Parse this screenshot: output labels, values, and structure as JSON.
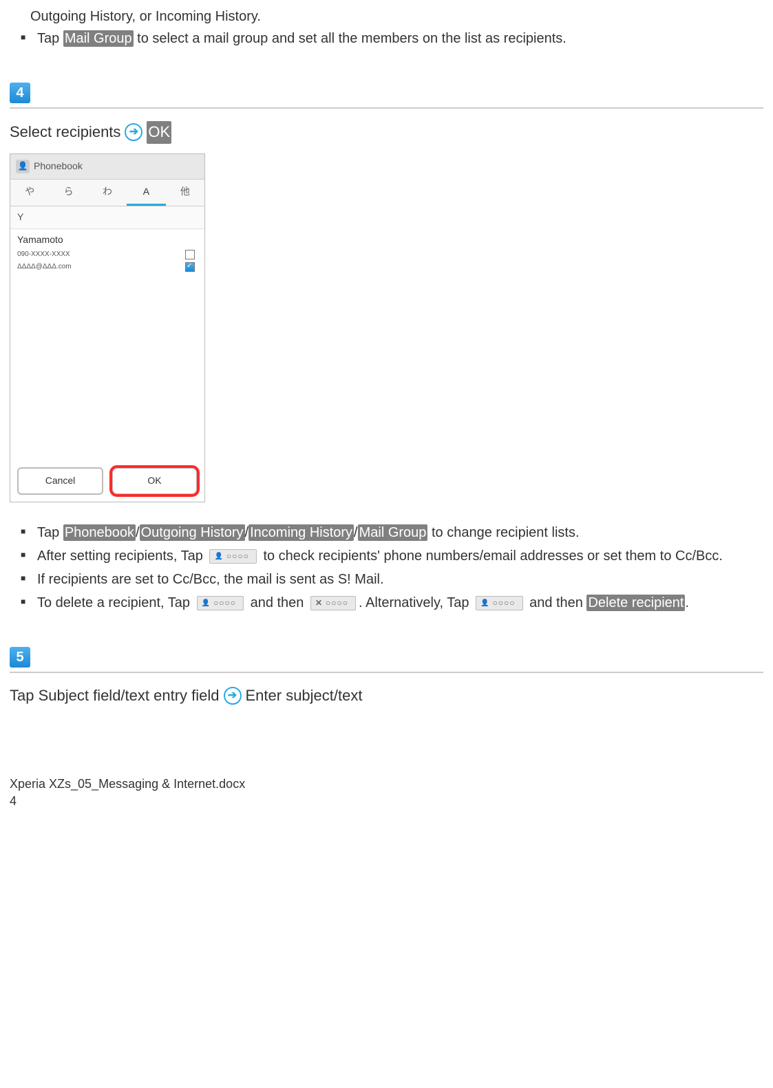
{
  "intro_fragment": "Outgoing History, or Incoming History.",
  "top_bullets": {
    "b1_pre": "Tap ",
    "b1_pill": "Mail Group",
    "b1_post": " to select a mail group and set all the members on the list as recipients."
  },
  "step4": {
    "num": "4",
    "line_pre": "Select recipients",
    "line_post": "OK"
  },
  "phone": {
    "title": "Phonebook",
    "tabs": {
      "t1": "や",
      "t2": "ら",
      "t3": "わ",
      "t4": "A",
      "t5": "他"
    },
    "section": "Y",
    "contact": "Yamamoto",
    "phone_num": "090-XXXX-XXXX",
    "email": "ΔΔΔΔ@ΔΔΔ.com",
    "cancel": "Cancel",
    "ok": "OK"
  },
  "mid_bullets": {
    "b1_pre": "Tap ",
    "b1_p1": "Phonebook",
    "b1_s1": "/",
    "b1_p2": "Outgoing History",
    "b1_s2": "/",
    "b1_p3": "Incoming History",
    "b1_s3": "/",
    "b1_p4": "Mail Group",
    "b1_post": " to change recipient lists.",
    "b2_pre": "After setting recipients, Tap ",
    "b2_post": " to check recipients' phone numbers/email addresses or set them to Cc/Bcc.",
    "b3": "If recipients are set to Cc/Bcc, the mail is sent as S! Mail.",
    "b4_pre": "To delete a recipient, Tap ",
    "b4_mid1": " and then ",
    "b4_mid2": ". Alternatively, Tap ",
    "b4_mid3": " and then ",
    "b4_pill": "Delete recipient",
    "b4_end": "."
  },
  "chip_text": "○○○○",
  "step5": {
    "num": "5",
    "line_pre": "Tap Subject field/text entry field",
    "line_post": "Enter subject/text"
  },
  "footer": {
    "filename": "Xperia XZs_05_Messaging & Internet.docx",
    "page": "4"
  }
}
